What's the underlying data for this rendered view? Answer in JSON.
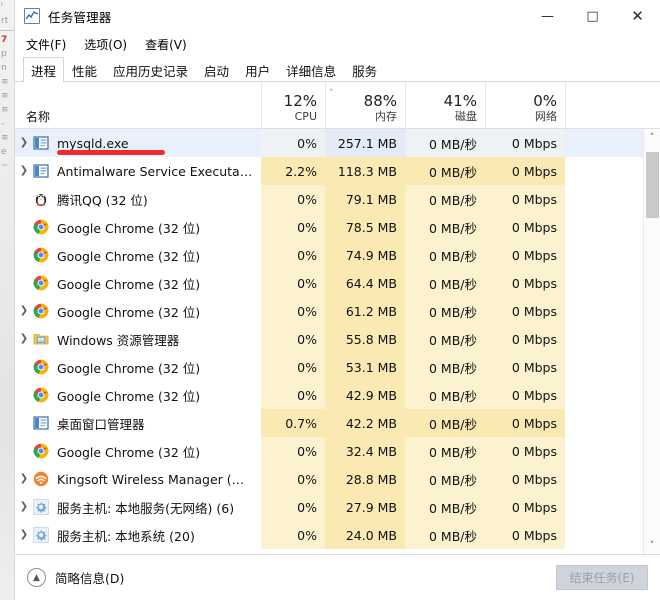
{
  "background_strip": {
    "fragments": [
      "ᵗ",
      "rt",
      "7",
      "p",
      "n",
      "≡",
      "≡",
      "≡",
      "-",
      "≡",
      "≡",
      "e",
      "~"
    ]
  },
  "window": {
    "title": "任务管理器",
    "icon": "task-manager-chart-icon",
    "controls": {
      "minimize": "—",
      "maximize": "□",
      "close": "✕"
    }
  },
  "menu": {
    "items": [
      {
        "label": "文件(F)"
      },
      {
        "label": "选项(O)"
      },
      {
        "label": "查看(V)"
      }
    ]
  },
  "tabs": {
    "active_index": 0,
    "items": [
      {
        "label": "进程"
      },
      {
        "label": "性能"
      },
      {
        "label": "应用历史记录"
      },
      {
        "label": "启动"
      },
      {
        "label": "用户"
      },
      {
        "label": "详细信息"
      },
      {
        "label": "服务"
      }
    ]
  },
  "columns": {
    "sort_caret": "ˇ",
    "name": {
      "pct": "",
      "label": "名称"
    },
    "cpu": {
      "pct": "12%",
      "label": "CPU"
    },
    "memory": {
      "pct": "88%",
      "label": "内存"
    },
    "disk": {
      "pct": "41%",
      "label": "磁盘"
    },
    "network": {
      "pct": "0%",
      "label": "网络"
    }
  },
  "annotation": {
    "type": "red-underline-marker",
    "color": "#ef2b2b",
    "targets_row": 0
  },
  "rows": [
    {
      "name": "mysqld.exe",
      "icon": "window-app-icon",
      "expand": true,
      "cpu": "0%",
      "memory": "257.1 MB",
      "disk": "0 MB/秒",
      "network": "0 Mbps",
      "selected": true,
      "cpu_hi": false
    },
    {
      "name": "Antimalware Service Executa…",
      "icon": "window-app-icon",
      "expand": true,
      "cpu": "2.2%",
      "memory": "118.3 MB",
      "disk": "0 MB/秒",
      "network": "0 Mbps",
      "selected": false,
      "cpu_hi": true
    },
    {
      "name": "腾讯QQ (32 位)",
      "icon": "qq-penguin-icon",
      "expand": false,
      "cpu": "0%",
      "memory": "79.1 MB",
      "disk": "0 MB/秒",
      "network": "0 Mbps",
      "selected": false,
      "cpu_hi": false
    },
    {
      "name": "Google Chrome (32 位)",
      "icon": "chrome-icon",
      "expand": false,
      "cpu": "0%",
      "memory": "78.5 MB",
      "disk": "0 MB/秒",
      "network": "0 Mbps",
      "selected": false,
      "cpu_hi": false
    },
    {
      "name": "Google Chrome (32 位)",
      "icon": "chrome-icon",
      "expand": false,
      "cpu": "0%",
      "memory": "74.9 MB",
      "disk": "0 MB/秒",
      "network": "0 Mbps",
      "selected": false,
      "cpu_hi": false
    },
    {
      "name": "Google Chrome (32 位)",
      "icon": "chrome-icon",
      "expand": false,
      "cpu": "0%",
      "memory": "64.4 MB",
      "disk": "0 MB/秒",
      "network": "0 Mbps",
      "selected": false,
      "cpu_hi": false
    },
    {
      "name": "Google Chrome (32 位)",
      "icon": "chrome-icon",
      "expand": true,
      "cpu": "0%",
      "memory": "61.2 MB",
      "disk": "0 MB/秒",
      "network": "0 Mbps",
      "selected": false,
      "cpu_hi": false
    },
    {
      "name": "Windows 资源管理器",
      "icon": "folder-explorer-icon",
      "expand": true,
      "cpu": "0%",
      "memory": "55.8 MB",
      "disk": "0 MB/秒",
      "network": "0 Mbps",
      "selected": false,
      "cpu_hi": false
    },
    {
      "name": "Google Chrome (32 位)",
      "icon": "chrome-icon",
      "expand": false,
      "cpu": "0%",
      "memory": "53.1 MB",
      "disk": "0 MB/秒",
      "network": "0 Mbps",
      "selected": false,
      "cpu_hi": false
    },
    {
      "name": "Google Chrome (32 位)",
      "icon": "chrome-icon",
      "expand": false,
      "cpu": "0%",
      "memory": "42.9 MB",
      "disk": "0 MB/秒",
      "network": "0 Mbps",
      "selected": false,
      "cpu_hi": false
    },
    {
      "name": "桌面窗口管理器",
      "icon": "window-app-icon",
      "expand": false,
      "cpu": "0.7%",
      "memory": "42.2 MB",
      "disk": "0 MB/秒",
      "network": "0 Mbps",
      "selected": false,
      "cpu_hi": true
    },
    {
      "name": "Google Chrome (32 位)",
      "icon": "chrome-icon",
      "expand": false,
      "cpu": "0%",
      "memory": "32.4 MB",
      "disk": "0 MB/秒",
      "network": "0 Mbps",
      "selected": false,
      "cpu_hi": false
    },
    {
      "name": "Kingsoft Wireless Manager (…",
      "icon": "kingsoft-wifi-icon",
      "expand": true,
      "cpu": "0%",
      "memory": "28.8 MB",
      "disk": "0 MB/秒",
      "network": "0 Mbps",
      "selected": false,
      "cpu_hi": false
    },
    {
      "name": "服务主机: 本地服务(无网络) (6)",
      "icon": "gear-service-icon",
      "expand": true,
      "cpu": "0%",
      "memory": "27.9 MB",
      "disk": "0 MB/秒",
      "network": "0 Mbps",
      "selected": false,
      "cpu_hi": false
    },
    {
      "name": "服务主机: 本地系统 (20)",
      "icon": "gear-service-icon",
      "expand": true,
      "cpu": "0%",
      "memory": "24.0 MB",
      "disk": "0 MB/秒",
      "network": "0 Mbps",
      "selected": false,
      "cpu_hi": false
    }
  ],
  "scrollbar": {
    "up": "˄",
    "down": "˅"
  },
  "footer": {
    "fewer_details_label": "简略信息(D)",
    "fewer_details_icon": "chevron-up-circle-icon",
    "end_task_label": "结束任务(E)",
    "end_task_disabled": true
  }
}
